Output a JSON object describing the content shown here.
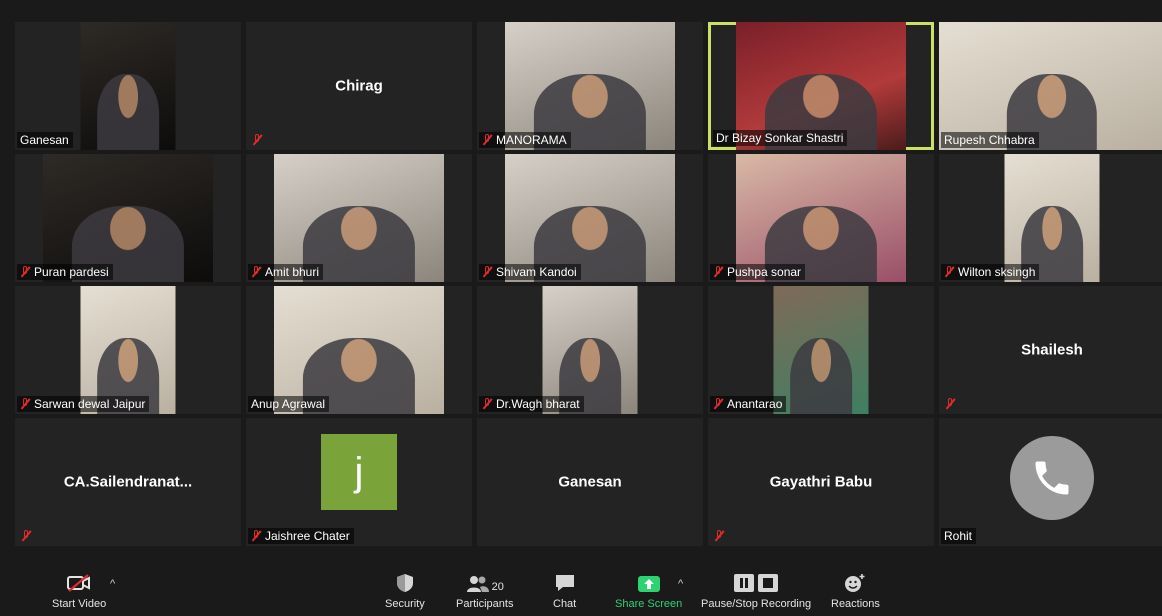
{
  "participants": [
    {
      "name": "Ganesan",
      "mode": "video",
      "muted": false
    },
    {
      "name": "Chirag",
      "mode": "name",
      "muted": true
    },
    {
      "name": "MANORAMA",
      "mode": "video",
      "muted": true
    },
    {
      "name": "Dr Bizay Sonkar Shastri",
      "mode": "video",
      "muted": false,
      "active": true
    },
    {
      "name": "Rupesh Chhabra",
      "mode": "video",
      "muted": false
    },
    {
      "name": "Puran pardesi",
      "mode": "video",
      "muted": true
    },
    {
      "name": "Amit bhuri",
      "mode": "video",
      "muted": true
    },
    {
      "name": "Shivam Kandoi",
      "mode": "video",
      "muted": true
    },
    {
      "name": "Pushpa sonar",
      "mode": "video",
      "muted": true
    },
    {
      "name": "Wilton sksingh",
      "mode": "video",
      "muted": true
    },
    {
      "name": "Sarwan dewal Jaipur",
      "mode": "video",
      "muted": true
    },
    {
      "name": "Anup Agrawal",
      "mode": "video",
      "muted": false
    },
    {
      "name": "Dr.Wagh bharat",
      "mode": "video",
      "muted": true
    },
    {
      "name": "Anantarao",
      "mode": "video",
      "muted": true
    },
    {
      "name": "Shailesh",
      "mode": "name",
      "muted": true
    },
    {
      "name": "CA.Sailendranat...",
      "mode": "name",
      "muted": true
    },
    {
      "name": "Jaishree Chater",
      "mode": "avatar",
      "avatar_letter": "j",
      "muted": true
    },
    {
      "name": "Ganesan",
      "mode": "name",
      "muted": false
    },
    {
      "name": "Gayathri Babu",
      "mode": "name",
      "muted": true
    },
    {
      "name": "Rohit",
      "mode": "phone",
      "muted": false
    }
  ],
  "toolbar": {
    "start_video": "Start Video",
    "security": "Security",
    "participants": "Participants",
    "participants_count": "20",
    "chat": "Chat",
    "share_screen": "Share Screen",
    "recording": "Pause/Stop Recording",
    "reactions": "Reactions"
  },
  "colors": {
    "active_speaker_border": "#c9e265",
    "muted_icon": "#e02b2b",
    "share_screen": "#2ed371",
    "avatar_bg": "#7aa33a"
  }
}
